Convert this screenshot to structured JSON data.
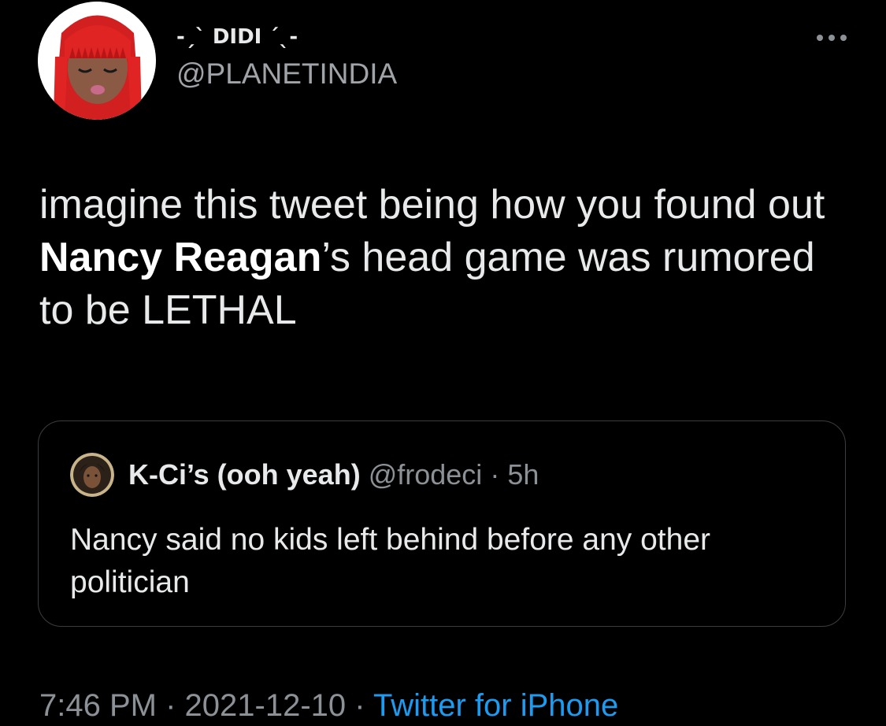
{
  "colors": {
    "background": "#000000",
    "text": "#e7e9ea",
    "muted": "#8b9196",
    "link": "#1d9bf0",
    "border": "#3a3d40"
  },
  "author": {
    "display_name": "-ˏˋ DIDI ˊˎ-",
    "handle": "@PLANETINDIA",
    "avatar": "avatar-red-hair-illustration"
  },
  "more_icon": "more-dots-icon",
  "tweet": {
    "text_part1": "imagine this tweet being how you found out ",
    "text_bold": "Nancy Reagan",
    "text_part2": "’s head game was rumored to be LETHAL"
  },
  "quoted": {
    "display_name": "K-Ci’s (ooh yeah)",
    "handle": "@frodeci",
    "separator": "·",
    "time": "5h",
    "text": "Nancy said no kids left behind before any other politician",
    "avatar": "avatar-portrait-photo"
  },
  "meta": {
    "time": "7:46 PM",
    "separator": "·",
    "date": "2021-12-10",
    "separator2": "·",
    "source": "Twitter for iPhone"
  }
}
